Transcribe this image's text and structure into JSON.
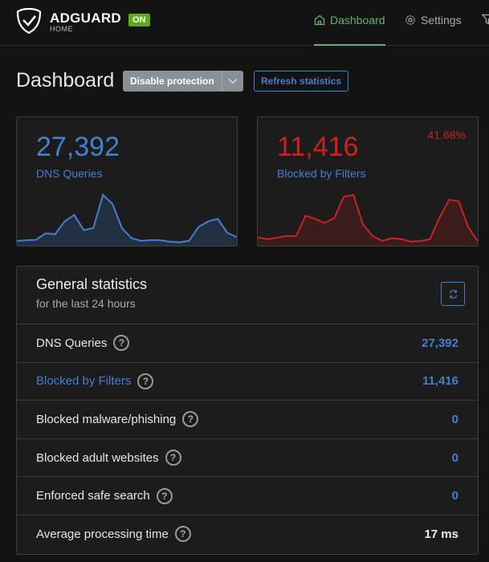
{
  "header": {
    "brand": "ADGUARD",
    "brand_sub": "HOME",
    "status_badge": "ON",
    "nav": [
      {
        "label": "Dashboard",
        "icon": "home-icon",
        "active": true
      },
      {
        "label": "Settings",
        "icon": "gear-icon"
      },
      {
        "label": "",
        "icon": "filter-icon"
      }
    ]
  },
  "page": {
    "title": "Dashboard",
    "disable_label": "Disable protection",
    "refresh_label": "Refresh statistics"
  },
  "cards": {
    "queries": {
      "value": "27,392",
      "label": "DNS Queries",
      "color": "#467fcf",
      "sparkline": [
        18,
        20,
        22,
        46,
        43,
        91,
        115,
        58,
        66,
        190,
        156,
        65,
        28,
        18,
        21,
        20,
        15,
        13,
        18,
        70,
        91,
        100,
        48,
        32
      ]
    },
    "blocked": {
      "value": "11,416",
      "label": "Blocked by Filters",
      "percent": "41.68%",
      "color": "#cd201f",
      "sparkline": [
        31,
        24,
        30,
        36,
        36,
        112,
        100,
        85,
        103,
        183,
        190,
        80,
        36,
        18,
        28,
        25,
        15,
        17,
        24,
        104,
        172,
        166,
        70,
        16
      ]
    }
  },
  "general": {
    "title": "General statistics",
    "subtitle": "for the last 24 hours",
    "rows": [
      {
        "label": "DNS Queries",
        "value": "27,392"
      },
      {
        "label": "Blocked by Filters",
        "value": "11,416"
      },
      {
        "label": "Blocked malware/phishing",
        "value": "0"
      },
      {
        "label": "Blocked adult websites",
        "value": "0"
      },
      {
        "label": "Enforced safe search",
        "value": "0"
      },
      {
        "label": "Average processing time",
        "value": "17 ms"
      }
    ]
  }
}
